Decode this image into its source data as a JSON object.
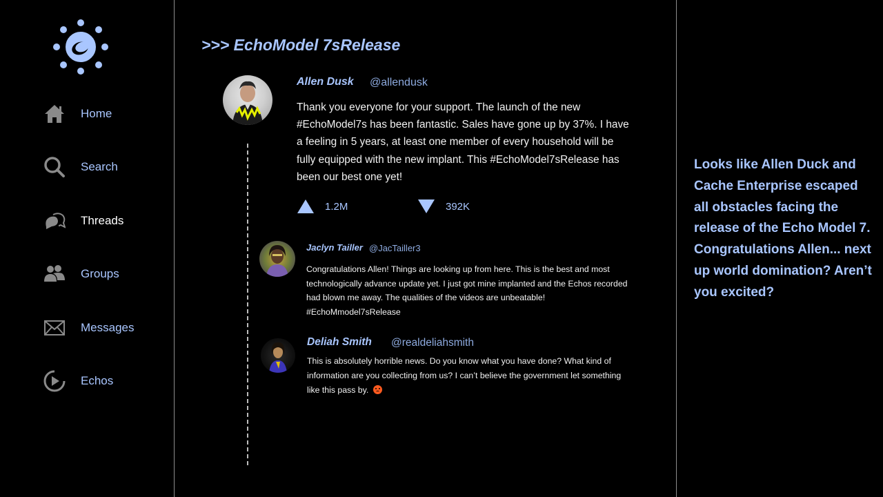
{
  "sidebar": {
    "items": [
      {
        "label": "Home",
        "icon": "home-icon"
      },
      {
        "label": "Search",
        "icon": "search-icon"
      },
      {
        "label": "Threads",
        "icon": "threads-icon",
        "active": true
      },
      {
        "label": "Groups",
        "icon": "groups-icon"
      },
      {
        "label": "Messages",
        "icon": "envelope-icon"
      },
      {
        "label": "Echos",
        "icon": "play-circle-icon"
      }
    ]
  },
  "feed": {
    "title": ">>> EchoModel 7sRelease",
    "post": {
      "author": "Allen Dusk",
      "handle": "@allendusk",
      "body": "Thank you everyone for your support. The launch of the new #EchoModel7s has been fantastic. Sales have gone up by 37%. I have a feeling in 5 years, at least one member of every household will be fully equipped with the new implant. This #EchoModel7sRelease has been our best one yet!",
      "upvotes": "1.2M",
      "downvotes": "392K"
    },
    "replies": [
      {
        "author": "Jaclyn Tailler",
        "handle": "@JacTailler3",
        "body": "Congratulations Allen! Things are looking up from here. This is the best and most technologically advance update yet. I just got mine implanted and the Echos recorded had blown me away. The qualities of the videos are unbeatable! #EchoMmodel7sRelease"
      },
      {
        "author": "Deliah Smith",
        "handle": "@realdeliahsmith",
        "body": "This is absolutely horrible news.  Do you know what you have done? What kind of information are you collecting from us? I can’t believe the government let something like this pass by."
      }
    ]
  },
  "right_panel": {
    "note": "Looks like Allen Duck and Cache Enterprise escaped all obstacles facing the release of the Echo Model 7. Congratulations Allen... next up world domination? Aren’t you excited?"
  },
  "colors": {
    "accent": "#a9c6ff",
    "background": "#000000",
    "divider": "#8e8e8e"
  }
}
